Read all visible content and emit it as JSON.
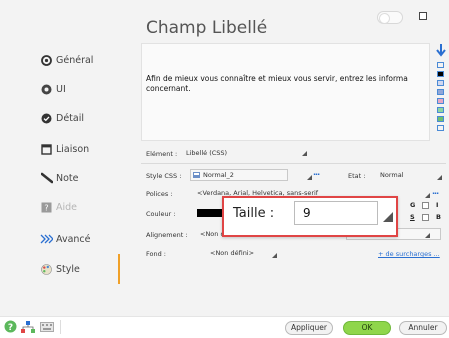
{
  "window": {
    "title": "Champ Libellé"
  },
  "sidebar": {
    "items": [
      {
        "label": "Général",
        "icon": "circle-dot-icon",
        "disabled": false
      },
      {
        "label": "UI",
        "icon": "eye-icon",
        "disabled": false
      },
      {
        "label": "Détail",
        "icon": "check-circle-icon",
        "disabled": false
      },
      {
        "label": "Liaison",
        "icon": "window-icon",
        "disabled": false
      },
      {
        "label": "Note",
        "icon": "pencil-icon",
        "disabled": false
      },
      {
        "label": "Aide",
        "icon": "help-icon",
        "disabled": true
      },
      {
        "label": "Avancé",
        "icon": "chevrons-right-icon",
        "disabled": false
      },
      {
        "label": "Style",
        "icon": "palette-icon",
        "disabled": false
      }
    ],
    "selected": "Style"
  },
  "preview": {
    "text": "Afin de mieux vous connaître et mieux vous servir, entrez les informa concernant."
  },
  "form": {
    "element_label": "Elément :",
    "element_value": "Libellé (CSS)",
    "style_css_label": "Style CSS :",
    "style_css_value": "Normal_2",
    "etat_label": "Etat :",
    "etat_value": "Normal",
    "polices_label": "Polices :",
    "polices_value": "<Verdana, Arial, Helvetica, sans-serif",
    "couleur_label": "Couleur :",
    "couleur_value": "#000000",
    "alignement_label": "Alignement :",
    "alignement_value": "<Non d",
    "fond_label": "Fond :",
    "fond_value": "<Non défini>",
    "bold_label": "G",
    "italic_label": "I",
    "underline_label": "S",
    "strike_label": "B",
    "surcharges_link": "+ de surcharges ..."
  },
  "popup": {
    "label": "Taille :",
    "value": "9"
  },
  "buttons": {
    "apply": "Appliquer",
    "ok": "OK",
    "cancel": "Annuler"
  },
  "colors": {
    "accent": "#f0a028",
    "ok_green": "#8fd64b",
    "highlight_border": "#e04545",
    "link": "#2a6fd1"
  },
  "preview_swatches": [
    "#ffffff",
    "#000000",
    "#cfd8f0",
    "#8fa6d8",
    "#e6a7c4",
    "#8fd6a0",
    "#6fc06f",
    "#ffffff"
  ]
}
